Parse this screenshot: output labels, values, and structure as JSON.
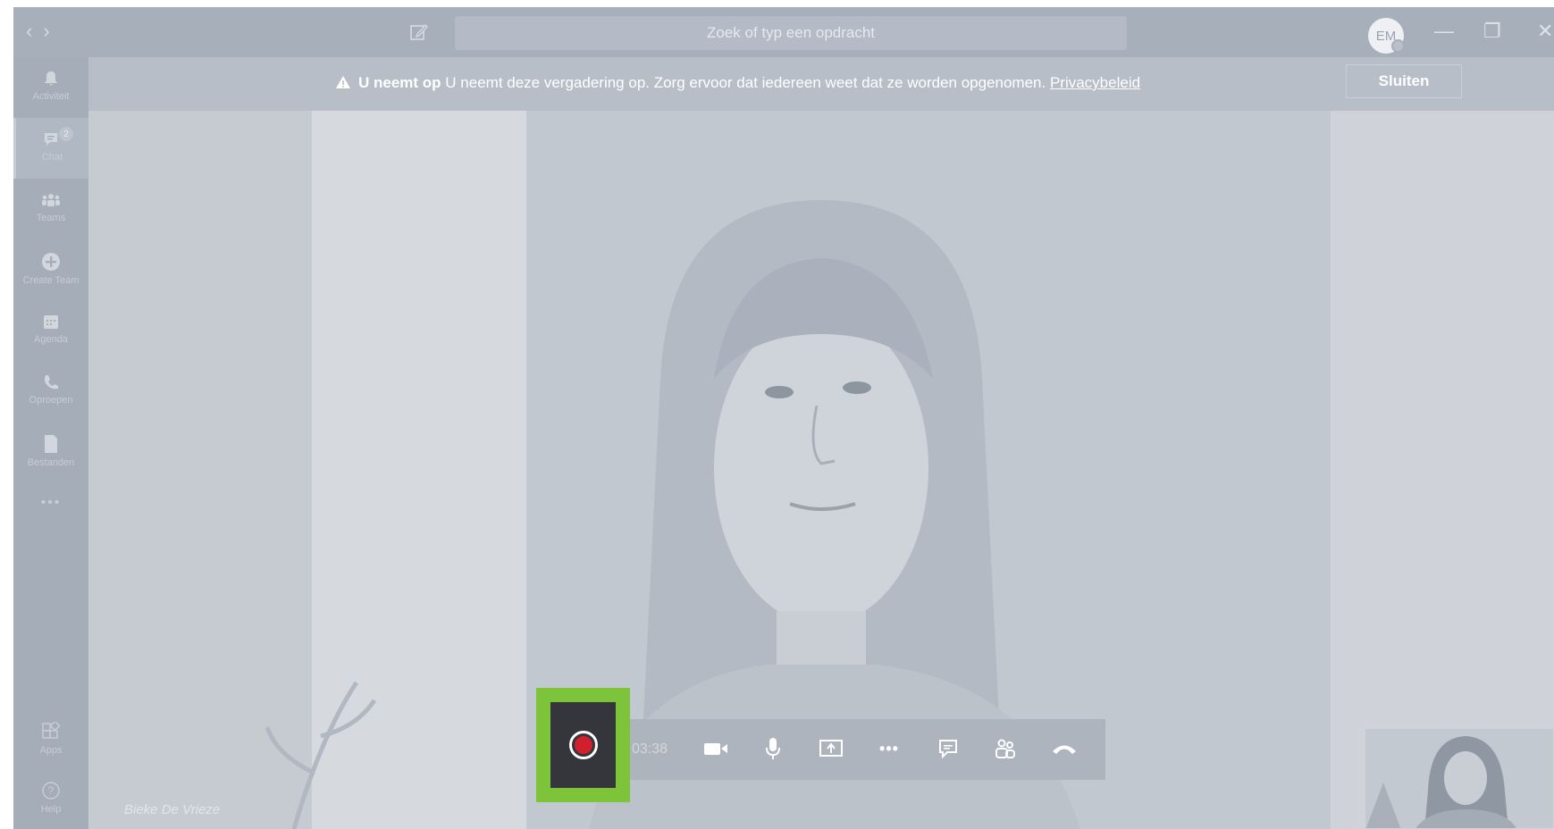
{
  "titlebar": {
    "nav_back": "‹",
    "nav_forward": "›",
    "search_placeholder": "Zoek of typ een opdracht",
    "avatar_initials": "EM",
    "minimize": "—",
    "restore": "❐",
    "close": "✕"
  },
  "rail": {
    "items": [
      {
        "label": "Activiteit",
        "icon": "bell-icon"
      },
      {
        "label": "Chat",
        "icon": "chat-icon",
        "badge": "2"
      },
      {
        "label": "Teams",
        "icon": "teams-icon"
      },
      {
        "label": "Create Team",
        "icon": "plus-circle-icon"
      },
      {
        "label": "Agenda",
        "icon": "calendar-icon"
      },
      {
        "label": "Oproepen",
        "icon": "phone-icon"
      },
      {
        "label": "Bestanden",
        "icon": "file-icon"
      },
      {
        "label": "•••",
        "icon": "more-icon"
      }
    ],
    "bottom": [
      {
        "label": "Apps",
        "icon": "apps-icon"
      },
      {
        "label": "Help",
        "icon": "help-icon"
      }
    ]
  },
  "banner": {
    "title": "U neemt op",
    "message": "U neemt deze vergadering op. Zorg ervoor dat iedereen weet dat ze worden opgenomen.",
    "link": "Privacybeleid",
    "close_label": "Sluiten"
  },
  "stage": {
    "participant_name": "Bieke De Vrieze"
  },
  "controls": {
    "timer": "03:38",
    "buttons": [
      "record-icon",
      "video-icon",
      "microphone-icon",
      "share-screen-icon",
      "more-icon",
      "conversation-icon",
      "participants-icon",
      "hangup-icon"
    ],
    "more_label": "•••"
  },
  "colors": {
    "highlight": "#7ec43a",
    "record": "#d21f2d",
    "overlay": "#a9b1bd"
  }
}
